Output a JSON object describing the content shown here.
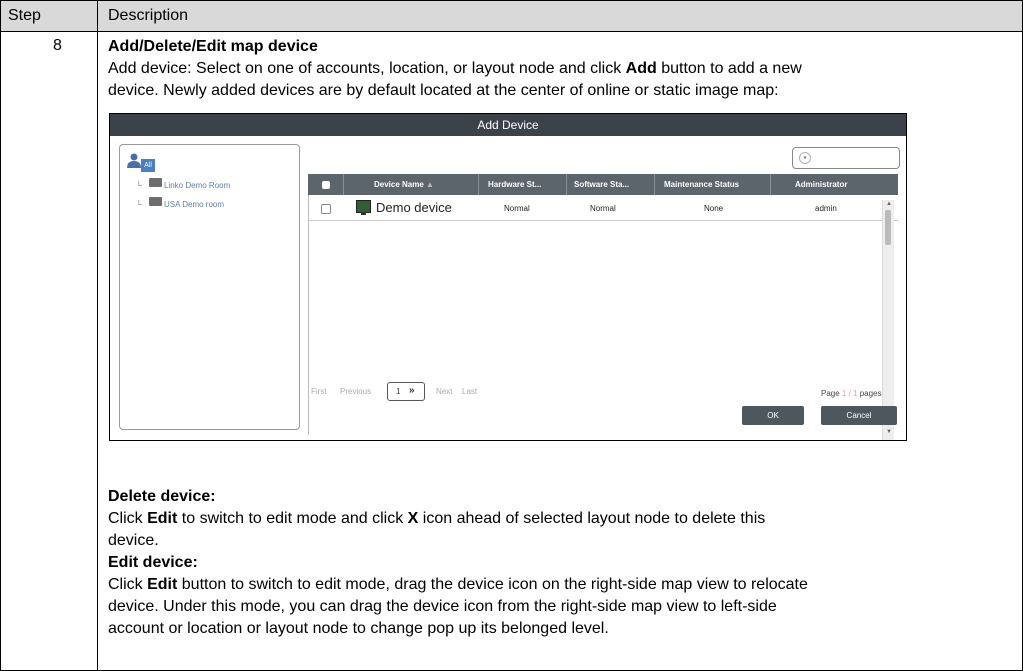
{
  "table": {
    "header": {
      "step": "Step",
      "description": "Description"
    },
    "step_number": "8"
  },
  "content": {
    "heading": "Add/Delete/Edit map device",
    "add_line1_prefix": "Add device: Select on one of accounts, location, or layout node and click ",
    "add_bold": "Add",
    "add_line1_suffix": " button to add a new",
    "add_line2": "device. Newly added devices are by default located at the center of online or static image map:",
    "delete_heading": "Delete device:",
    "delete_line1_prefix": "Click ",
    "delete_edit_bold": "Edit",
    "delete_line1_mid": " to switch to edit mode and click ",
    "delete_x_bold": "X",
    "delete_line1_suffix": " icon ahead of selected layout node to delete this",
    "delete_line2": "device.",
    "edit_heading": "Edit device:",
    "edit_line1_prefix": "Click ",
    "edit_bold": "Edit",
    "edit_line1_suffix": " button to switch to edit mode, drag the device icon on the right-side map view to relocate",
    "edit_line2": "device. Under this mode, you can drag the device icon from the right-side map view to left-side",
    "edit_line3": "account or location or layout node to change pop up its belonged level."
  },
  "dialog": {
    "title": "Add Device",
    "tree": {
      "root_label": "All",
      "items": [
        "Linko Demo Room",
        "USA Demo room"
      ]
    },
    "grid": {
      "columns": [
        "Device Name",
        "Hardware St...",
        "Software Sta...",
        "Maintenance Status",
        "Administrator"
      ],
      "sort_indicator": "▲",
      "rows": [
        {
          "device_name": "Demo device",
          "hardware": "Normal",
          "software": "Normal",
          "maintenance": "None",
          "administrator": "admin"
        }
      ]
    },
    "pager": {
      "first": "First",
      "previous": "Previous",
      "page_value": "1",
      "next": "Next",
      "last": "Last",
      "page_label": "Page",
      "current": "1 / 1",
      "pages_label": "pages"
    },
    "buttons": {
      "ok": "OK",
      "cancel": "Cancel"
    }
  }
}
